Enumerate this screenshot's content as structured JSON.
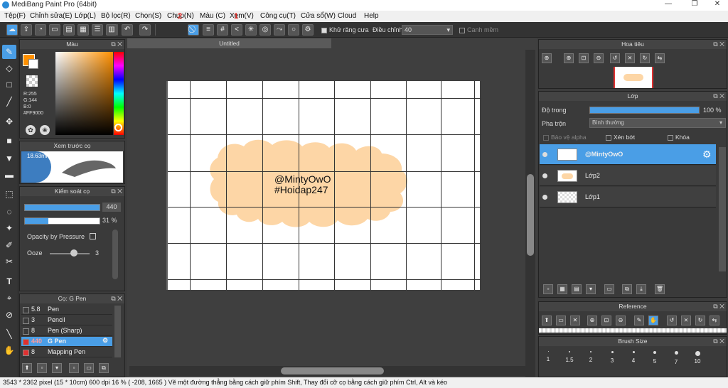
{
  "window": {
    "title": "MediBang Paint Pro (64bit)",
    "minimize": "—",
    "maximize": "❐",
    "close": "✕"
  },
  "menu": [
    "Tệp(F)",
    "Chỉnh sửa(E)",
    "Lớp(L)",
    "Bộ lọc(R)",
    "Chọn(S)",
    "Chụp(N)",
    "Màu (C)",
    "Xem(V)",
    "Công cụ(T)",
    "Cửa sổ(W)",
    "Cloud",
    "Help"
  ],
  "toolbar": {
    "antialias_label": "Khử răng cưa",
    "correction_label": "Điều chỉnh",
    "correction_value": "40",
    "snap_label": "Canh mềm",
    "annotation_1": "1",
    "annotation_2": "2"
  },
  "color_panel": {
    "title": "Màu",
    "r": "R:255",
    "g": "G:144",
    "b": "B:0",
    "hex": "#FF9000",
    "fg_color": "#ff9000"
  },
  "brush_preview": {
    "title": "Xem trước cọ",
    "size": "18.63mm"
  },
  "brush_control": {
    "title": "Kiểm soát cọ",
    "size_value": "440",
    "opacity_value": "31 %",
    "opacity_by_pressure": "Opacity by Pressure",
    "ooze_label": "Ooze",
    "ooze_value": "3"
  },
  "brush_list": {
    "title": "Cọ: G Pen",
    "items": [
      {
        "size": "5.8",
        "name": "Pen",
        "swatch": "#3a3a3a",
        "size_color": "#ff6b6b"
      },
      {
        "size": "3",
        "name": "Pencil",
        "swatch": "#3a3a3a",
        "size_color": "#eeeeee"
      },
      {
        "size": "8",
        "name": "Pen (Sharp)",
        "swatch": "#3a3a3a",
        "size_color": "#eeeeee"
      },
      {
        "size": "440",
        "name": "G Pen",
        "swatch": "#e03030",
        "size_color": "#ff7b7b"
      },
      {
        "size": "8",
        "name": "Mapping Pen",
        "swatch": "#e03030",
        "size_color": "#eeeeee"
      }
    ]
  },
  "document": {
    "tab_title": "Untitled",
    "text_line1": "@MintyOwO",
    "text_line2": "#Hoidap247"
  },
  "navigator": {
    "title": "Hoa tiêu"
  },
  "layer_panel": {
    "title": "Lớp",
    "opacity_label": "Độ trong",
    "opacity_value": "100 %",
    "opacity_fraction": 1.0,
    "blend_label": "Pha trộn",
    "blend_value": "Bình thường",
    "protect_alpha": "Bảo vệ alpha",
    "clipping": "Xén bớt",
    "lock": "Khóa",
    "layers": [
      {
        "name": "@MintyOwO",
        "selected": true
      },
      {
        "name": "Lớp2",
        "selected": false
      },
      {
        "name": "Lớp1",
        "selected": false
      }
    ]
  },
  "reference": {
    "title": "Reference"
  },
  "brush_size": {
    "title": "Brush Size",
    "sizes": [
      "1",
      "1.5",
      "2",
      "3",
      "4",
      "5",
      "7",
      "10"
    ]
  },
  "status": {
    "text": "3543 * 2362 pixel  (15 * 10cm)  600 dpi  16 %  ( -208, 1665 )  Vẽ một đường thẳng bằng cách giữ phím Shift, Thay đổi cỡ cọ bằng cách giữ phím Ctrl, Alt và kéo"
  }
}
